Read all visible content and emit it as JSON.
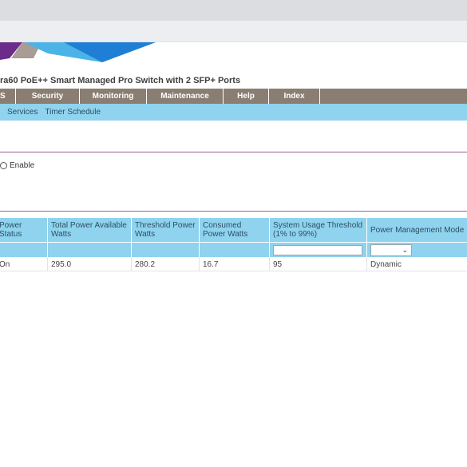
{
  "colors": {
    "nav_bg": "#8a7d72",
    "subnav_bg": "#8fd3ee",
    "divider": "#a0628f",
    "logo_colors": [
      "#6c2a8a",
      "#4bb3e6",
      "#1f7fd4",
      "#a89c94"
    ]
  },
  "header": {
    "product_title": "ra60 PoE++ Smart Managed Pro Switch with 2 SFP+ Ports"
  },
  "main_nav": {
    "tabs": [
      "S",
      "Security",
      "Monitoring",
      "Maintenance",
      "Help",
      "Index"
    ]
  },
  "sub_nav": {
    "items": [
      "Services",
      "Timer Schedule"
    ]
  },
  "settings": {
    "enable_label": "Enable"
  },
  "table": {
    "headers": {
      "power_status": "Power Status",
      "total_power": "Total Power Available Watts",
      "threshold_power": "Threshold Power Watts",
      "consumed_power": "Consumed Power Watts",
      "usage_threshold": "System Usage Threshold (1% to 99%)",
      "mode": "Power Management Mode"
    },
    "row": {
      "power_status": "On",
      "total_power": "295.0",
      "threshold_power": "280.2",
      "consumed_power": "16.7",
      "usage_threshold": "95",
      "mode": "Dynamic"
    },
    "usage_threshold_input": "",
    "mode_select": "",
    "select_icon": "chevron-down-icon"
  }
}
